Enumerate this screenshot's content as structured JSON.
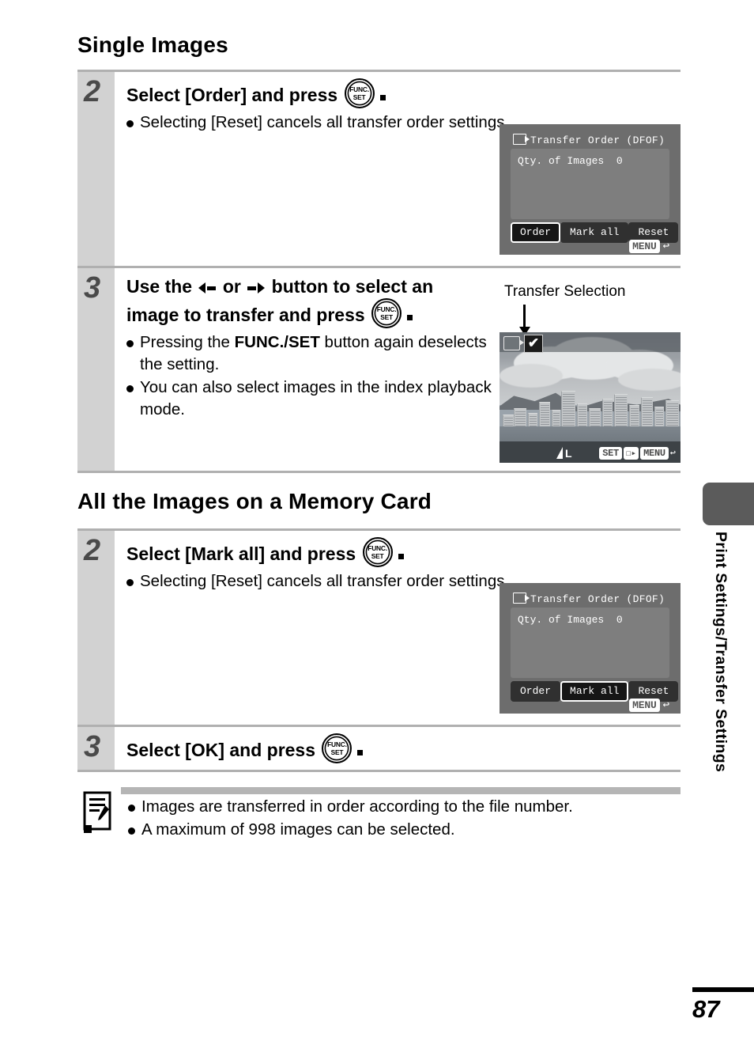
{
  "page": {
    "number": "87",
    "side_tab_label": "Print Settings/Transfer Settings"
  },
  "sections": [
    {
      "heading": "Single Images",
      "steps": [
        {
          "number": "2",
          "title_before": "Select [Order] and press",
          "title_icon": "func-set-icon",
          "title_after": ".",
          "bullets": [
            "Selecting [Reset] cancels all transfer order settings."
          ],
          "screen": {
            "type": "menu",
            "title": "Transfer Order (DFOF)",
            "qty_label": "Qty. of Images",
            "qty_value": "0",
            "buttons": [
              "Order",
              "Mark all",
              "Reset"
            ],
            "selected_button": "Order",
            "menu_chip": "MENU",
            "return_arrow": "↩"
          }
        },
        {
          "number": "3",
          "title_line1_a": "Use the",
          "title_line1_or": "or",
          "title_line1_b": "button to",
          "title_line2": "select an image to transfer",
          "title_line3": "and press",
          "title_after": ".",
          "bullets_rich": [
            {
              "pre": "Pressing the ",
              "bold": "FUNC./SET",
              "post": " button again deselects the setting."
            },
            {
              "pre": "You can also select images in the index playback mode.",
              "bold": "",
              "post": ""
            }
          ],
          "screen": {
            "type": "photo",
            "callout_label": "Transfer Selection",
            "check_glyph": "✔",
            "quality_label": "L",
            "set_chip": "SET",
            "menu_chip": "MENU",
            "return_arrow": "↩"
          }
        }
      ]
    },
    {
      "heading": "All the Images on a Memory Card",
      "steps": [
        {
          "number": "2",
          "title_before": "Select [Mark all] and press",
          "title_icon": "func-set-icon",
          "title_after": ".",
          "bullets": [
            "Selecting [Reset] cancels all transfer order settings."
          ],
          "screen": {
            "type": "menu",
            "title": "Transfer Order (DFOF)",
            "qty_label": "Qty. of Images",
            "qty_value": "0",
            "buttons": [
              "Order",
              "Mark all",
              "Reset"
            ],
            "selected_button": "Mark all",
            "menu_chip": "MENU",
            "return_arrow": "↩"
          }
        },
        {
          "number": "3",
          "title_before": "Select [OK] and press",
          "title_icon": "func-set-icon",
          "title_after": ".",
          "bullets": []
        }
      ]
    }
  ],
  "note": {
    "icon": "note-pencil-icon",
    "bullets": [
      "Images are transferred in order according to the file number.",
      "A maximum of 998 images can be selected."
    ]
  },
  "func_set_icon": {
    "top": "FUNC.",
    "bottom": "SET"
  },
  "colors": {
    "step_column": "#d2d2d2",
    "rule": "#b0b0b0",
    "lcd_bg": "#6d6d6d",
    "side_tab": "#5b5b5b"
  }
}
